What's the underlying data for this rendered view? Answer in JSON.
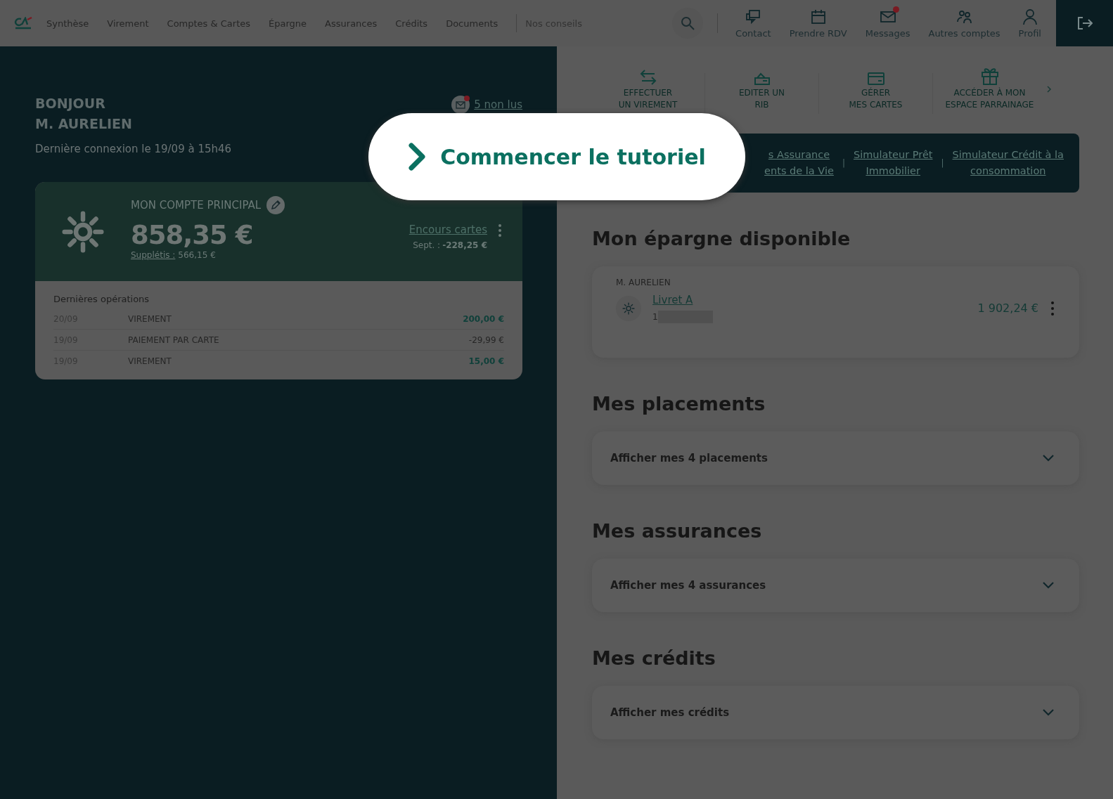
{
  "nav": {
    "items": [
      {
        "label": "Synthèse"
      },
      {
        "label": "Virement"
      },
      {
        "label": "Comptes & Cartes"
      },
      {
        "label": "Épargne"
      },
      {
        "label": "Assurances"
      },
      {
        "label": "Crédits"
      },
      {
        "label": "Documents"
      }
    ],
    "extra": "Nos conseils"
  },
  "shortcuts": [
    {
      "kind": "contact",
      "label": "Contact",
      "notification": false
    },
    {
      "kind": "calendar",
      "label": "Prendre RDV",
      "notification": false
    },
    {
      "kind": "mail",
      "label": "Messages",
      "notification": true
    },
    {
      "kind": "people",
      "label": "Autres comptes",
      "notification": false
    },
    {
      "kind": "person",
      "label": "Profil",
      "notification": false
    }
  ],
  "greeting": {
    "lines": [
      "BONJOUR",
      "M. AURELIEN"
    ],
    "last_login": "Dernière connexion le 19/09 à 15h46",
    "messages_link": "5 non lus"
  },
  "main_account": {
    "title": "MON COMPTE PRINCIPAL",
    "balance": "858,35 €",
    "supplement_label": "Supplétis :",
    "supplement_value": "566,15 €",
    "cards_link": "Encours cartes",
    "cards_month": "Sept. :",
    "cards_amount": "-228,25 €"
  },
  "operations": {
    "title": "Dernières opérations",
    "rows": [
      {
        "date": "20/09",
        "label": "VIREMENT",
        "amount": "200,00 €",
        "kind": "credit"
      },
      {
        "date": "19/09",
        "label": "PAIEMENT PAR CARTE",
        "amount": "-29,99 €",
        "kind": "debit"
      },
      {
        "date": "19/09",
        "label": "VIREMENT",
        "amount": "15,00 €",
        "kind": "credit"
      }
    ]
  },
  "quick_actions": [
    {
      "kind": "transfer",
      "label": "EFFECTUER\nUN VIREMENT"
    },
    {
      "kind": "rib",
      "label": "EDITER UN\nRIB"
    },
    {
      "kind": "card",
      "label": "GÉRER\nMES CARTES"
    },
    {
      "kind": "gift",
      "label": "ACCÉDER À MON\nESPACE PARRAINAGE"
    }
  ],
  "links_banner": {
    "separator": "|",
    "links": [
      {
        "label": "s Assurance\nents de la Vie"
      },
      {
        "label": "Simulateur Prêt\nImmobilier"
      },
      {
        "label": "Simulateur Crédit à la\nconsommation"
      }
    ]
  },
  "savings": {
    "title": "Mon épargne disponible",
    "owner": "M. AURELIEN",
    "account": "Livret A",
    "number": "1",
    "amount": "1 902,24 €"
  },
  "sections": [
    {
      "title": "Mes placements",
      "toggle": "Afficher mes 4 placements",
      "expanded": false
    },
    {
      "title": "Mes assurances",
      "toggle": "Afficher mes 4 assurances",
      "expanded": false
    },
    {
      "title": "Mes crédits",
      "toggle": "Afficher mes crédits",
      "expanded": false
    }
  ],
  "tutorial": {
    "label": "Commencer le tutoriel"
  }
}
